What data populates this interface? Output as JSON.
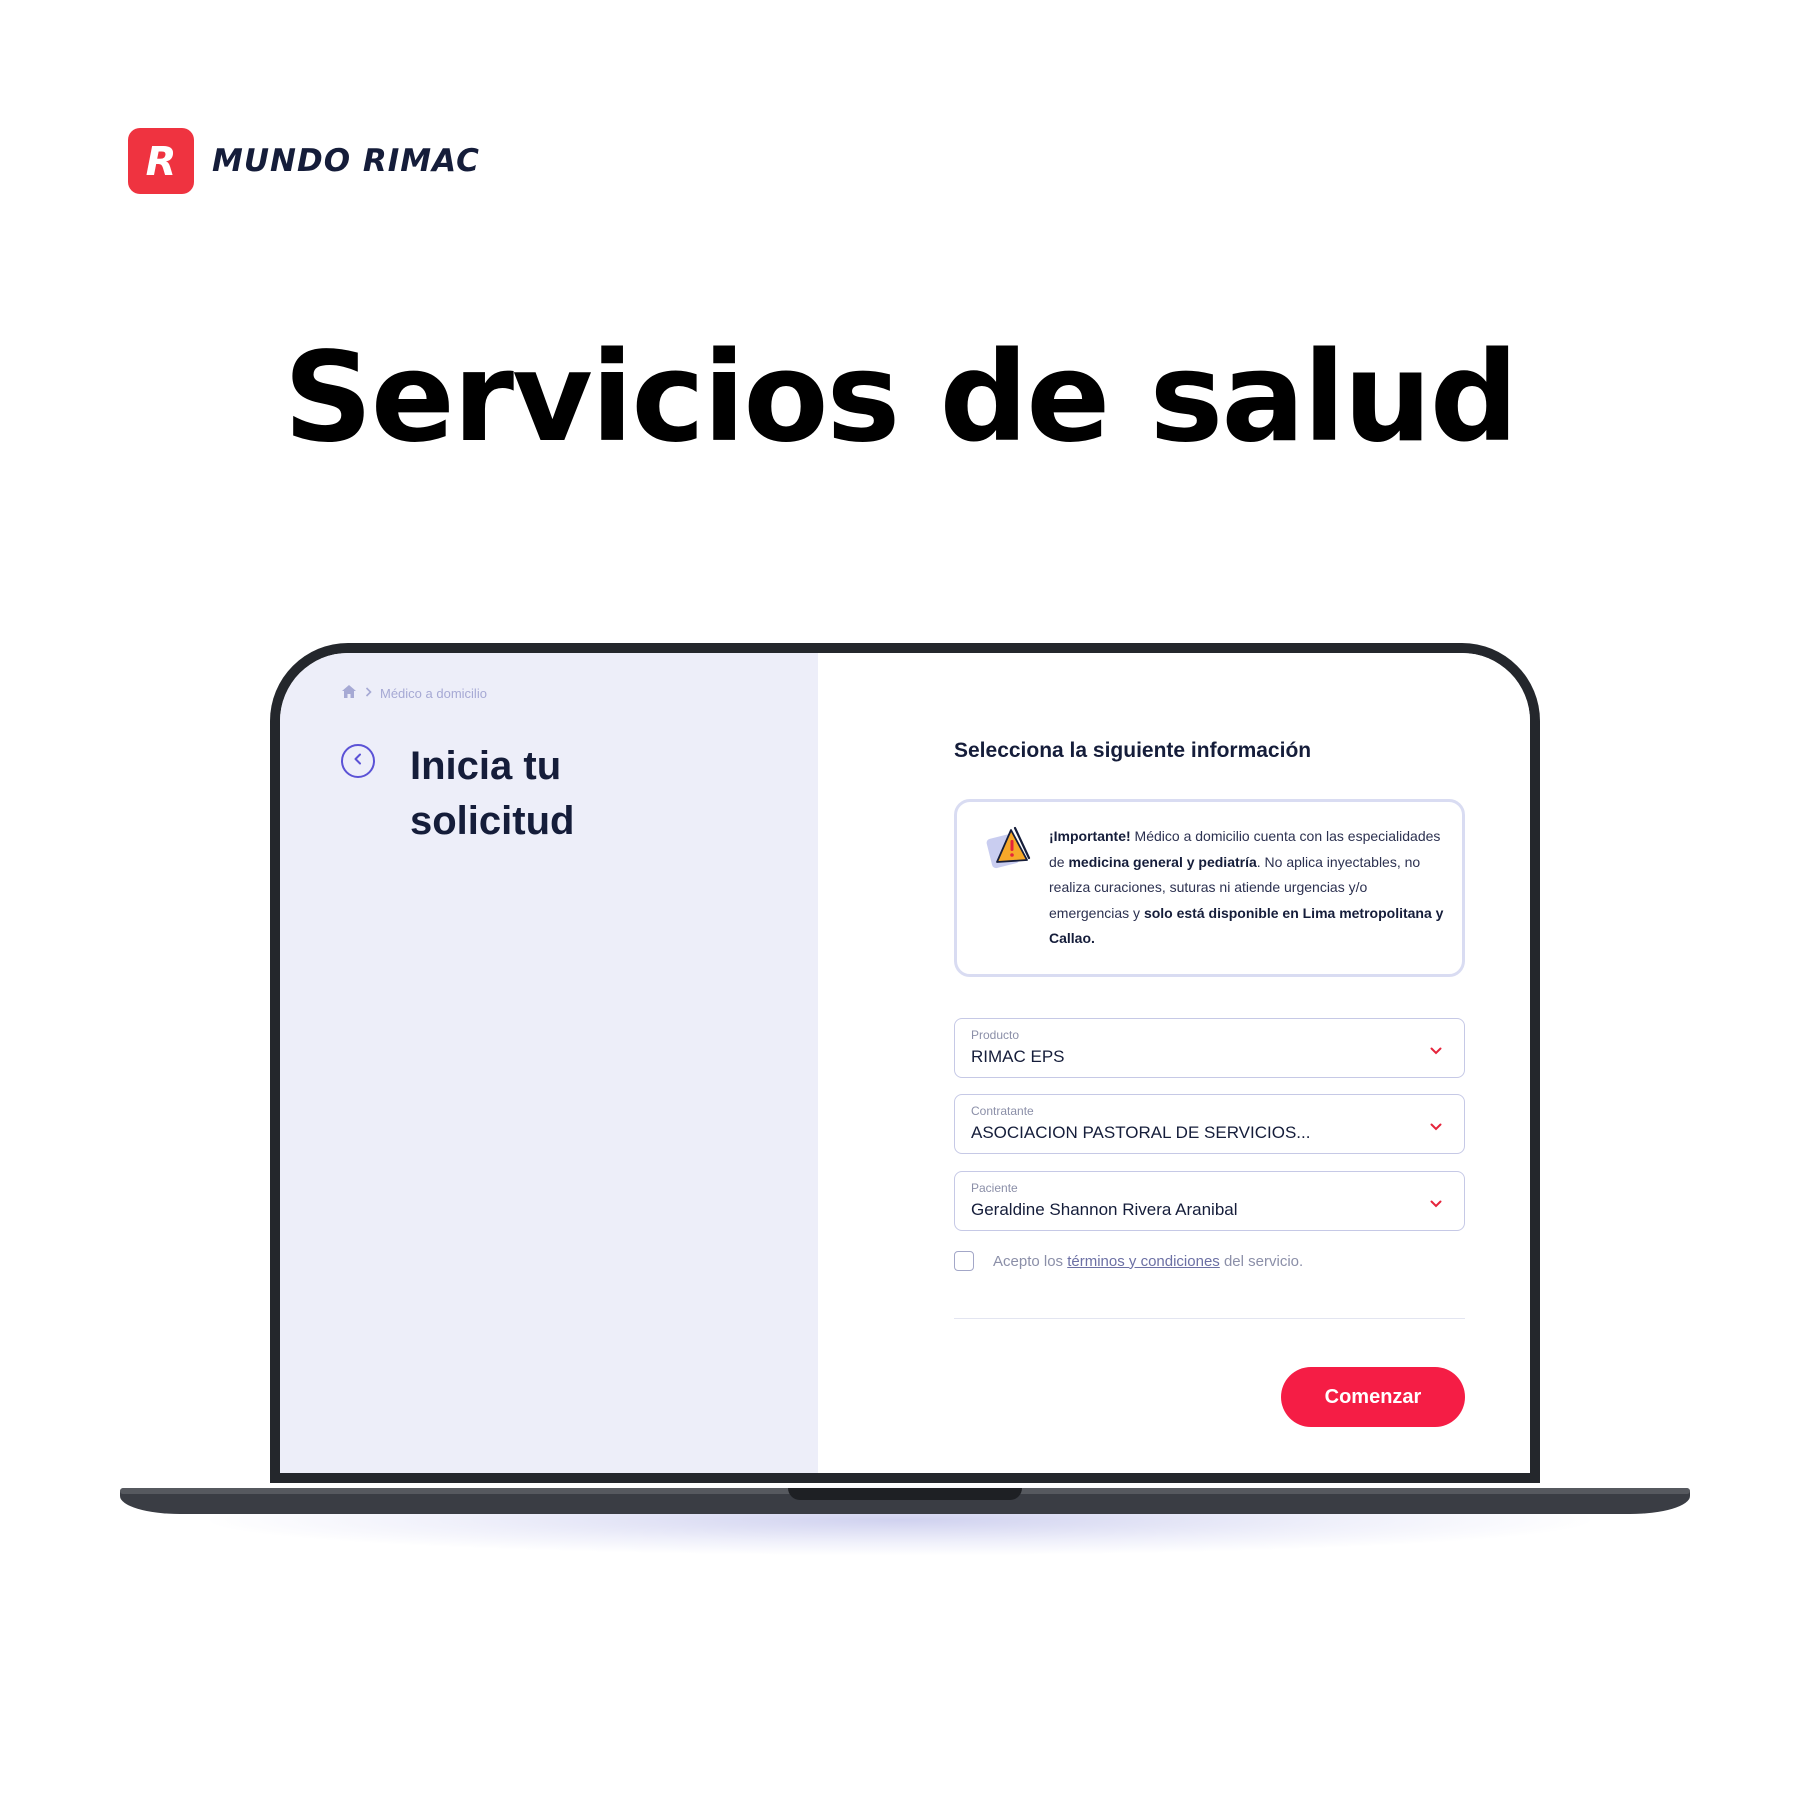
{
  "brand": {
    "logo_letter": "R",
    "name": "MUNDO RIMAC",
    "color": "#ef3340"
  },
  "hero": {
    "title": "Servicios de salud"
  },
  "app": {
    "breadcrumb": {
      "current": "Médico a domicilio"
    },
    "left": {
      "title": "Inicia tu solicitud"
    },
    "right": {
      "section_title": "Selecciona la siguiente información",
      "notice": {
        "t1": "¡Importante!",
        "t2": " Médico a domicilio cuenta con las especialidades de ",
        "t3": "medicina general y pediatría",
        "t4": ". No aplica inyectables, no realiza curaciones, suturas ni atiende urgencias y/o emergencias y ",
        "t5": "solo está disponible en Lima metropolitana y Callao."
      },
      "fields": [
        {
          "label": "Producto",
          "value": "RIMAC EPS"
        },
        {
          "label": "Contratante",
          "value": "ASOCIACION PASTORAL DE SERVICIOS..."
        },
        {
          "label": "Paciente",
          "value": "Geraldine Shannon Rivera Aranibal"
        }
      ],
      "terms": {
        "prefix": "Acepto los ",
        "link": "términos y condiciones",
        "suffix": " del servicio.",
        "checked": false
      },
      "cta": "Comenzar"
    },
    "colors": {
      "accent": "#f51d45",
      "primary": "#5b52d6",
      "panel_bg": "#edeef9",
      "text": "#151d3a"
    },
    "icons": [
      "home-icon",
      "chevron-right-icon",
      "back-arrow-icon",
      "warning-icon",
      "chevron-down-icon"
    ]
  }
}
